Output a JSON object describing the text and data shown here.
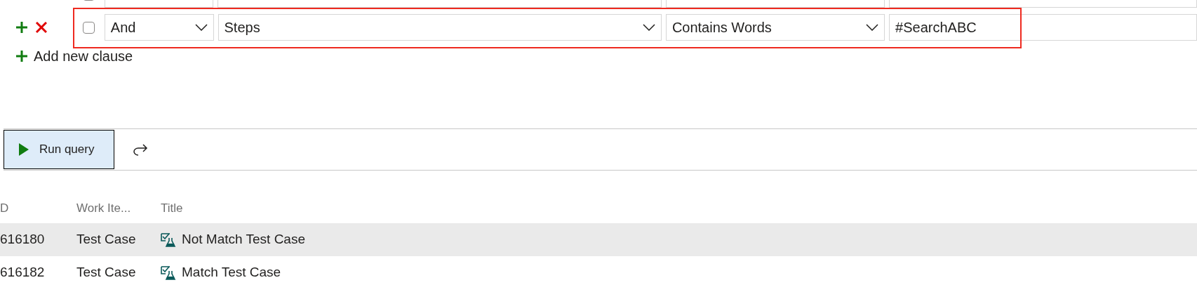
{
  "clauses": [
    {
      "checked": false,
      "highlighted": false
    },
    {
      "checked": false,
      "highlighted": true,
      "and_or": "And",
      "field": "Steps",
      "operator": "Contains Words",
      "value": "#SearchABC"
    }
  ],
  "add_clause": "Add new clause",
  "run_button": "Run query",
  "results": {
    "columns": [
      "D",
      "Work Ite...",
      "Title"
    ],
    "rows": [
      {
        "id": "616180",
        "type": "Test Case",
        "title": "Not Match Test Case",
        "selected": true
      },
      {
        "id": "616182",
        "type": "Test Case",
        "title": "Match Test Case",
        "selected": false
      }
    ]
  }
}
